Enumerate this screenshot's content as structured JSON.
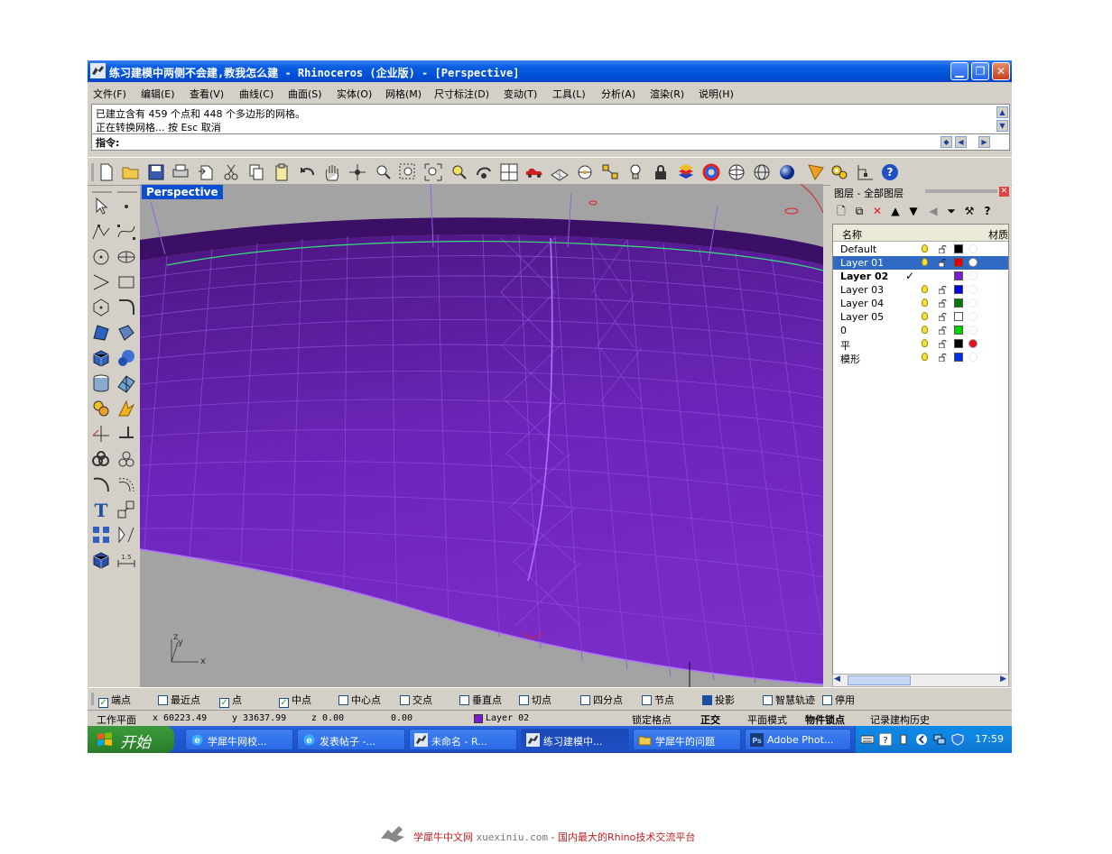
{
  "window": {
    "title": "练习建模中两侧不会建,教我怎么建 - Rhinoceros (企业版) - [Perspective]",
    "min_icon": "minimize-icon",
    "max_icon": "restore-icon",
    "close_icon": "close-icon"
  },
  "menu": [
    "文件(F)",
    "编辑(E)",
    "查看(V)",
    "曲线(C)",
    "曲面(S)",
    "实体(O)",
    "网格(M)",
    "尺寸标注(D)",
    "变动(T)",
    "工具(L)",
    "分析(A)",
    "渲染(R)",
    "说明(H)"
  ],
  "command": {
    "history_1": "已建立含有 459 个点和 448 个多边形的网格。",
    "history_2": "正在转换网格... 按 Esc 取消",
    "prompt_label": "指令:",
    "input_value": ""
  },
  "toolbar_icons": [
    "new-file-icon",
    "open-folder-icon",
    "save-icon",
    "print-icon",
    "import-icon",
    "cut-icon",
    "copy-icon",
    "paste-icon",
    "undo-icon",
    "pan-hand-icon",
    "rotate-view-icon",
    "zoom-window-icon",
    "zoom-dynamic-icon",
    "zoom-extents-icon",
    "zoom-selected-icon",
    "rotate-camera-icon",
    "four-viewports-icon",
    "car-icon",
    "grid-plane-icon",
    "object-snap-icon",
    "select-points-icon",
    "light-bulb-icon",
    "lock-icon",
    "layer-icon",
    "color-wheel-icon",
    "sphere-wireframe-icon",
    "sphere-shaded-icon",
    "sphere-rendered-icon",
    "render-icon",
    "settings-gears-icon",
    "dimension-icon",
    "help-icon"
  ],
  "viewport": {
    "label": "Perspective",
    "axis_z": "z",
    "axis_y": "y",
    "axis_x": "x"
  },
  "layers_panel": {
    "title": "图层 - 全部图层",
    "col_name": "名称",
    "col_material": "材质",
    "rows": [
      {
        "name": "Default",
        "color": "#000000",
        "current": false,
        "selected": false,
        "material": false
      },
      {
        "name": "Layer 01",
        "color": "#e00000",
        "current": false,
        "selected": true,
        "material": true
      },
      {
        "name": "Layer 02",
        "color": "#7a1fd0",
        "current": true,
        "selected": false,
        "material": false
      },
      {
        "name": "Layer 03",
        "color": "#0000e0",
        "current": false,
        "selected": false,
        "material": false
      },
      {
        "name": "Layer 04",
        "color": "#007a00",
        "current": false,
        "selected": false,
        "material": false
      },
      {
        "name": "Layer 05",
        "color": "#ffffff",
        "current": false,
        "selected": false,
        "material": false
      },
      {
        "name": "0",
        "color": "#00d000",
        "current": false,
        "selected": false,
        "material": false
      },
      {
        "name": "平",
        "color": "#000000",
        "current": false,
        "selected": false,
        "material": true
      },
      {
        "name": "模形",
        "color": "#0030e0",
        "current": false,
        "selected": false,
        "material": false
      }
    ],
    "current_mark": "✓"
  },
  "osnaps": [
    {
      "label": "端点",
      "checked": true
    },
    {
      "label": "最近点",
      "checked": false
    },
    {
      "label": "点",
      "checked": true
    },
    {
      "label": "中点",
      "checked": true
    },
    {
      "label": "中心点",
      "checked": false
    },
    {
      "label": "交点",
      "checked": false
    },
    {
      "label": "垂直点",
      "checked": false
    },
    {
      "label": "切点",
      "checked": false
    },
    {
      "label": "四分点",
      "checked": false
    },
    {
      "label": "节点",
      "checked": false
    },
    {
      "label": "投影",
      "checked": "filled"
    },
    {
      "label": "智慧轨迹",
      "checked": false
    },
    {
      "label": "停用",
      "checked": false
    }
  ],
  "status": {
    "cplane": "工作平面",
    "x": "x 60223.49",
    "y": "y 33637.99",
    "z": "z 0.00",
    "dist": "0.00",
    "layer": "Layer 02",
    "layer_color": "#7a1fd0",
    "grid_snap": "锁定格点",
    "ortho": "正交",
    "planar": "平面模式",
    "osnap": "物件锁点",
    "history": "记录建构历史"
  },
  "taskbar": {
    "start": "开始",
    "tasks": [
      {
        "label": "学犀牛网校...",
        "icon": "ie-icon"
      },
      {
        "label": "发表帖子 -...",
        "icon": "ie-icon"
      },
      {
        "label": "未命名 - R...",
        "icon": "rhino-icon"
      },
      {
        "label": "练习建模中...",
        "icon": "rhino-icon"
      },
      {
        "label": "学犀牛的问题",
        "icon": "folder-icon"
      },
      {
        "label": "Adobe Phot...",
        "icon": "photoshop-icon"
      }
    ],
    "clock": "17:59"
  },
  "footer": {
    "brand": "学犀牛中文网",
    "url": "xuexiniu.com",
    "slogan": "- 国内最大的Rhino技术交流平台"
  }
}
